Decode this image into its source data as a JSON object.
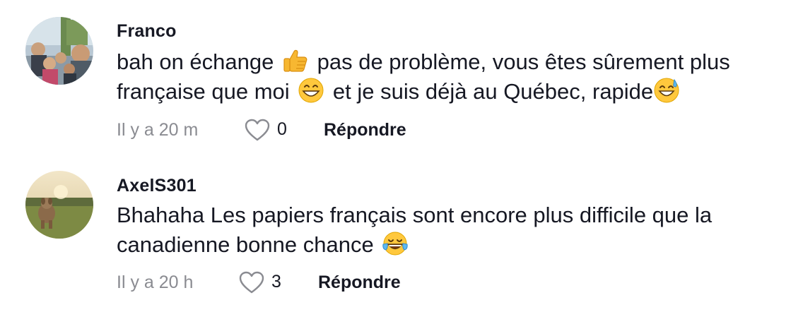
{
  "comments": [
    {
      "username": "Franco",
      "avatar_icon": "profile-photo-group",
      "text_lines": [
        {
          "parts": [
            "bah on échange ",
            " pas de problème, vous êtes sûrement plus"
          ],
          "emoji": "thumbs-up-icon"
        },
        {
          "parts": [
            "française que moi ",
            " et je suis déjà au Québec, rapide"
          ],
          "emoji": "grinning-face-icon"
        }
      ],
      "trailing_emoji": "sweat-smile-face-icon",
      "time": "Il y a 20 m",
      "like_count": "0",
      "reply_label": "Répondre"
    },
    {
      "username": "AxelS301",
      "avatar_icon": "profile-photo-dog",
      "text_lines": [
        {
          "parts": [
            "Bhahaha Les papiers français sont encore plus difficile que la"
          ]
        },
        {
          "parts": [
            "canadienne bonne chance "
          ]
        }
      ],
      "trailing_emoji": "tears-of-joy-face-icon",
      "time": "Il y a 20 h",
      "like_count": "3",
      "reply_label": "Répondre"
    }
  ],
  "colors": {
    "text": "#161823",
    "secondary": "#8a8b91",
    "emoji_yellow": "#ffc83d",
    "thumb_yellow": "#f7b731"
  }
}
